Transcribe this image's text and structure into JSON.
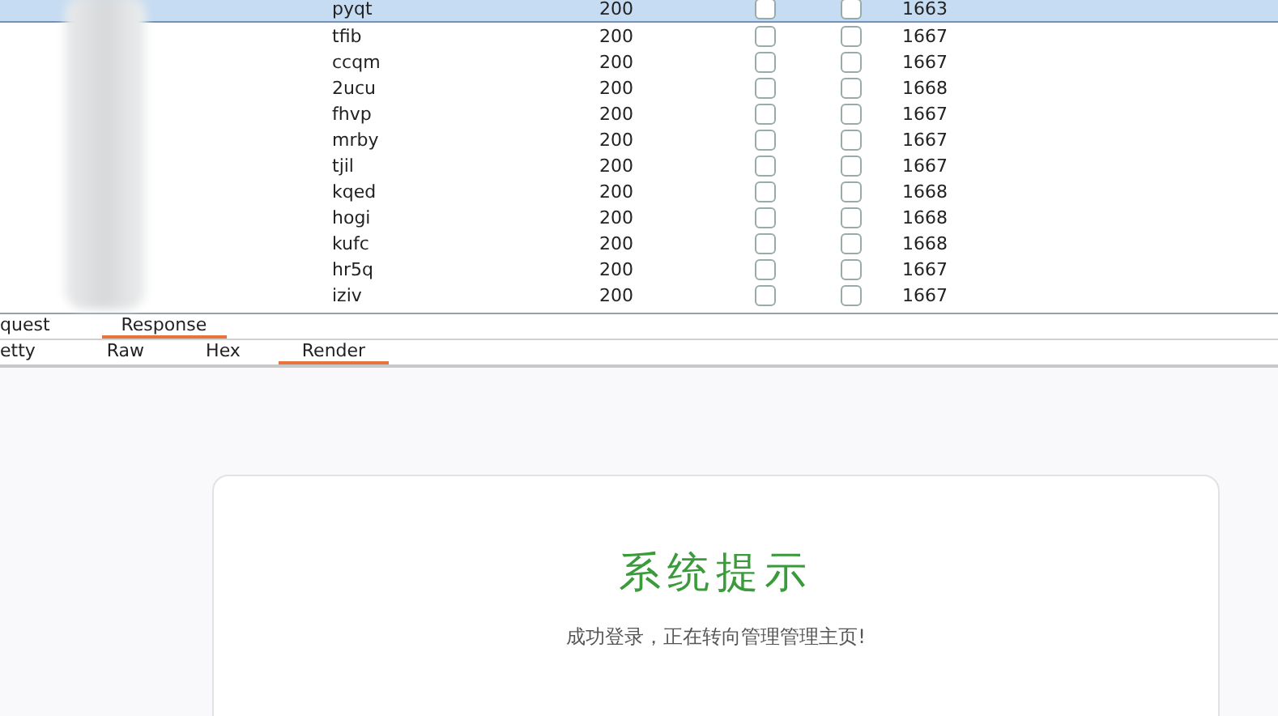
{
  "table": {
    "rows": [
      {
        "column_2": "pyqt",
        "column_3": "200",
        "column_4": false,
        "column_5": false,
        "column_6": "1663",
        "selected": true
      },
      {
        "column_2": "tfib",
        "column_3": "200",
        "column_4": false,
        "column_5": false,
        "column_6": "1667",
        "selected": false
      },
      {
        "column_2": "ccqm",
        "column_3": "200",
        "column_4": false,
        "column_5": false,
        "column_6": "1667",
        "selected": false
      },
      {
        "column_2": "2ucu",
        "column_3": "200",
        "column_4": false,
        "column_5": false,
        "column_6": "1668",
        "selected": false
      },
      {
        "column_2": "fhvp",
        "column_3": "200",
        "column_4": false,
        "column_5": false,
        "column_6": "1667",
        "selected": false
      },
      {
        "column_2": "mrby",
        "column_3": "200",
        "column_4": false,
        "column_5": false,
        "column_6": "1667",
        "selected": false
      },
      {
        "column_2": "tjil",
        "column_3": "200",
        "column_4": false,
        "column_5": false,
        "column_6": "1667",
        "selected": false
      },
      {
        "column_2": "kqed",
        "column_3": "200",
        "column_4": false,
        "column_5": false,
        "column_6": "1668",
        "selected": false
      },
      {
        "column_2": "hogi",
        "column_3": "200",
        "column_4": false,
        "column_5": false,
        "column_6": "1668",
        "selected": false
      },
      {
        "column_2": "kufc",
        "column_3": "200",
        "column_4": false,
        "column_5": false,
        "column_6": "1668",
        "selected": false
      },
      {
        "column_2": "hr5q",
        "column_3": "200",
        "column_4": false,
        "column_5": false,
        "column_6": "1667",
        "selected": false
      },
      {
        "column_2": "iziv",
        "column_3": "200",
        "column_4": false,
        "column_5": false,
        "column_6": "1667",
        "selected": false
      }
    ]
  },
  "tabs": [
    {
      "label": "quest",
      "selected": false
    },
    {
      "label": "Response",
      "selected": true
    }
  ],
  "view_tabs": [
    {
      "label": "etty",
      "selected": false
    },
    {
      "label": "Raw",
      "selected": false
    },
    {
      "label": "Hex",
      "selected": false
    },
    {
      "label": "Render",
      "selected": true
    }
  ],
  "render": {
    "title": "系统提示",
    "message": "成功登录，正在转向管理管理主页!"
  }
}
